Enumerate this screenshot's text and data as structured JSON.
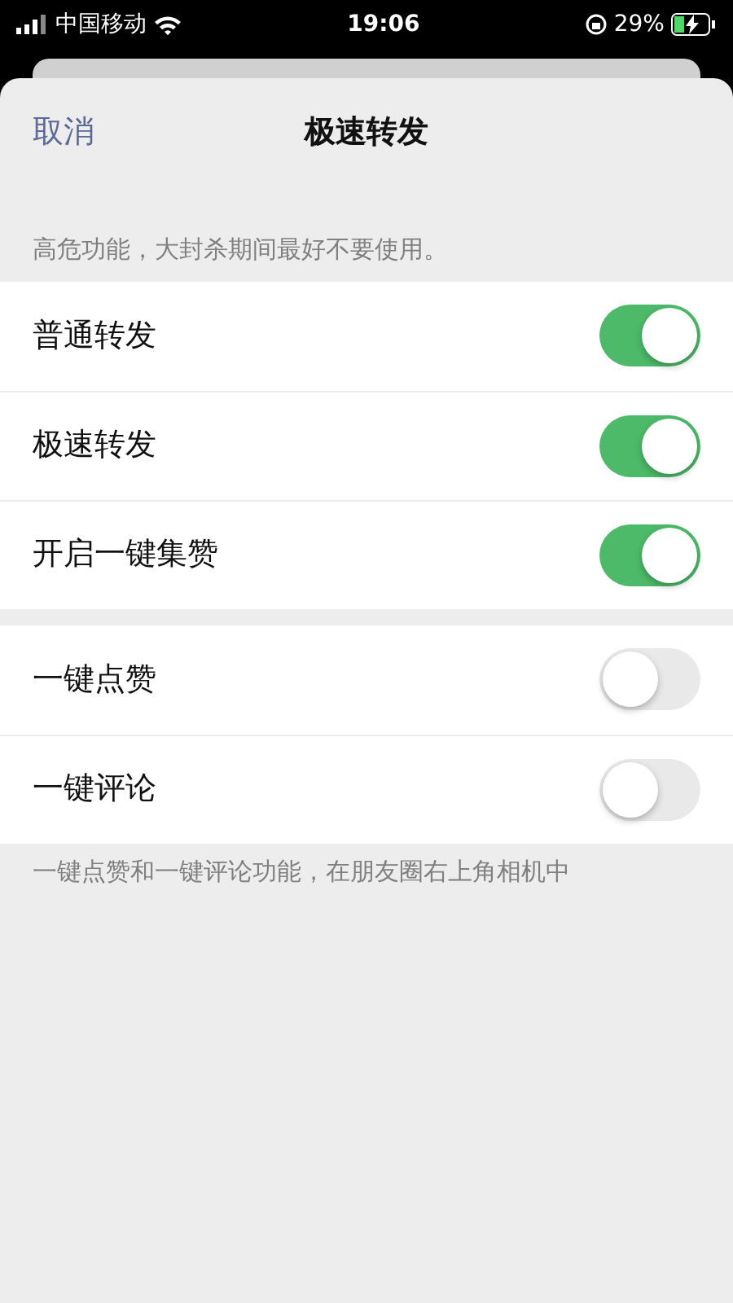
{
  "status_bar": {
    "carrier": "中国移动",
    "time": "19:06",
    "battery": "29%"
  },
  "nav": {
    "cancel": "取消",
    "title": "极速转发"
  },
  "sections": [
    {
      "header": "高危功能，大封杀期间最好不要使用。",
      "rows": [
        {
          "label": "普通转发",
          "on": true
        },
        {
          "label": "极速转发",
          "on": true
        },
        {
          "label": "开启一键集赞",
          "on": true
        }
      ]
    },
    {
      "footer": "一键点赞和一键评论功能，在朋友圈右上角相机中",
      "rows": [
        {
          "label": "一键点赞",
          "on": false
        },
        {
          "label": "一键评论",
          "on": false
        }
      ]
    }
  ]
}
